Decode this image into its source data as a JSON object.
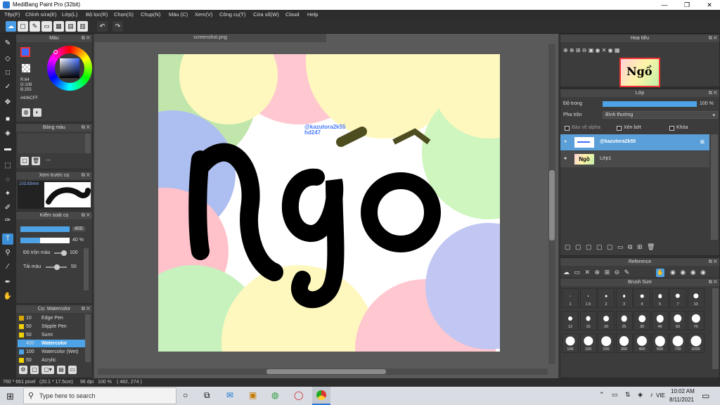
{
  "window": {
    "title": "MediBang Paint Pro (32bit)",
    "min": "—",
    "max": "❐",
    "close": "✕"
  },
  "menu": [
    "Tệp(F)",
    "Chỉnh sửa(E)",
    "Lớp(L)",
    "Bộ lọc(R)",
    "Chọn(S)",
    "Chụp(N)",
    "Màu (C)",
    "Xem(V)",
    "Công cụ(T)",
    "Cửa sổ(W)",
    "Cloud",
    "Help"
  ],
  "document": {
    "tab": "screenshot.png",
    "signature": "@kazutora2k55\nhd247",
    "art_text": "Ngồ"
  },
  "color_panel": {
    "title": "Màu",
    "r": "R:64",
    "g": "G:108",
    "b": "B:255",
    "hex": "#406CFF",
    "primary": "#406CFF"
  },
  "palette_panel": {
    "title": "Bảng màu",
    "dash": "---"
  },
  "preview_panel": {
    "title": "Xem trước cọ",
    "size": "103.83mm"
  },
  "brush_control": {
    "title": "Kiểm soát cọ",
    "size_value": "400",
    "opacity_value": "40 %",
    "blend_label": "Độ trộn màu",
    "blend_value": "100",
    "reload_label": "Tải màu",
    "reload_value": "50"
  },
  "brush_list": {
    "title": "Cọ: Watercolor",
    "items": [
      {
        "size": "10",
        "name": "Edge Pen",
        "color": "#d9a800"
      },
      {
        "size": "50",
        "name": "Stipple Pen",
        "color": "#f0d000"
      },
      {
        "size": "50",
        "name": "Sumi",
        "color": "#f0d000"
      },
      {
        "size": "400",
        "name": "Watercolor",
        "color": "#4da3e6",
        "selected": true
      },
      {
        "size": "100",
        "name": "Watercolor (Wet)",
        "color": "#4da3e6"
      },
      {
        "size": "50",
        "name": "Acrylic",
        "color": "#f0d000"
      }
    ]
  },
  "navigator": {
    "title": "Hoa tiêu"
  },
  "layer_panel": {
    "title": "Lớp",
    "opacity_label": "Độ trong",
    "opacity_value": "100 %",
    "blend_label": "Pha trộn",
    "blend_value": "Bình thường",
    "protect_alpha": "Bảo vệ alpha",
    "clipping": "Xén bớt",
    "lock": "Khóa",
    "layers": [
      {
        "name": "@kazutora2k55",
        "selected": true
      },
      {
        "name": "Lớp1",
        "selected": false
      }
    ]
  },
  "reference_panel": {
    "title": "Reference"
  },
  "brush_size_panel": {
    "title": "Brush Size",
    "sizes": [
      "1",
      "1.5",
      "2",
      "3",
      "4",
      "5",
      "7",
      "10",
      "12",
      "15",
      "20",
      "25",
      "30",
      "40",
      "50",
      "70",
      "100",
      "150",
      "200",
      "300",
      "400",
      "500",
      "700",
      "1000"
    ]
  },
  "status": {
    "dimensions": "760 * 661 pixel",
    "physical": "(20.1 * 17.5cm)",
    "dpi": "96 dpi",
    "zoom": "100 %",
    "cursor": "( 482, 274 )"
  },
  "taskbar": {
    "search_placeholder": "Type here to search",
    "time": "10:02 AM",
    "date": "8/11/2021",
    "lang": "VIE"
  }
}
